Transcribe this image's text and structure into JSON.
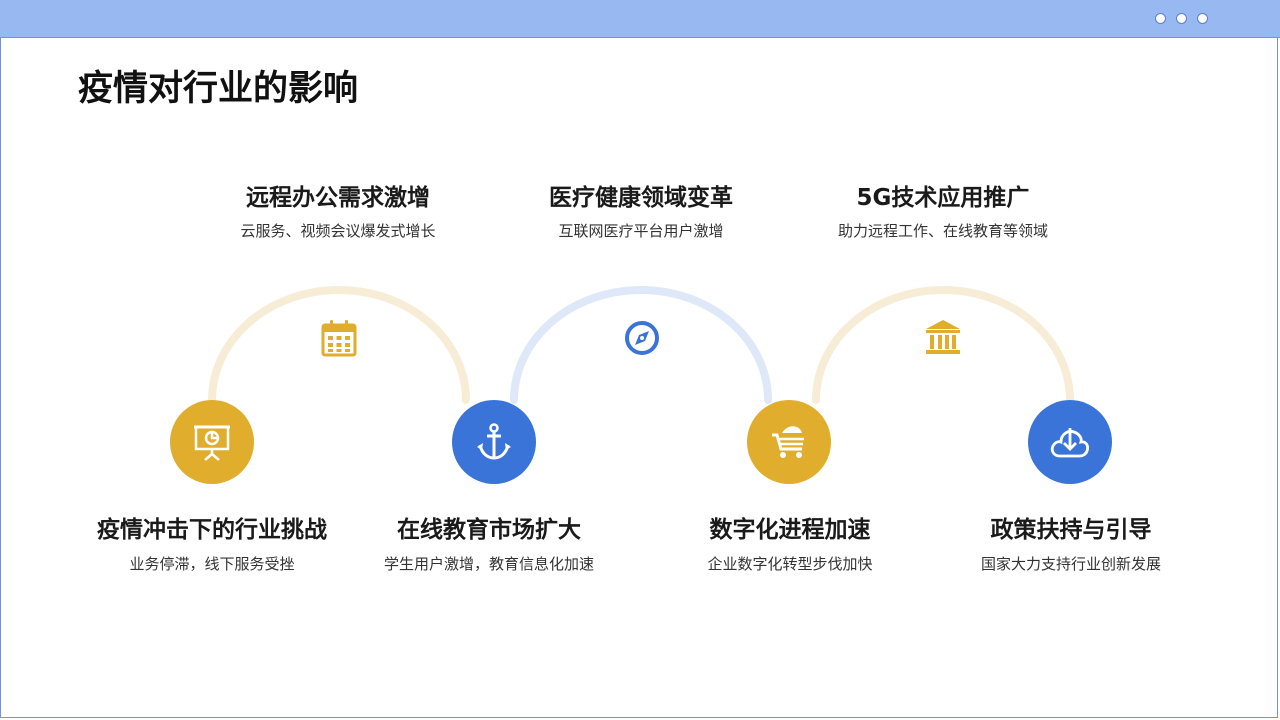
{
  "title": "疫情对行业的影响",
  "colors": {
    "gold": "#e1ad2c",
    "blue": "#3a74d9",
    "gold_light": "#f7edd6",
    "blue_light": "#dfe8f8"
  },
  "window_controls": [
    "dot",
    "dot",
    "dot"
  ],
  "top_items": [
    {
      "title": "远程办公需求激增",
      "desc": "云服务、视频会议爆发式增长",
      "icon": "calendar-icon"
    },
    {
      "title": "医疗健康领域变革",
      "desc": "互联网医疗平台用户激增",
      "icon": "compass-icon"
    },
    {
      "title": "5G技术应用推广",
      "desc": "助力远程工作、在线教育等领域",
      "icon": "bank-icon"
    }
  ],
  "bottom_items": [
    {
      "title": "疫情冲击下的行业挑战",
      "desc": "业务停滞，线下服务受挫",
      "icon": "presentation-icon"
    },
    {
      "title": "在线教育市场扩大",
      "desc": "学生用户激增，教育信息化加速",
      "icon": "anchor-icon"
    },
    {
      "title": "数字化进程加速",
      "desc": "企业数字化转型步伐加快",
      "icon": "cart-icon"
    },
    {
      "title": "政策扶持与引导",
      "desc": "国家大力支持行业创新发展",
      "icon": "download-cloud-icon"
    }
  ]
}
